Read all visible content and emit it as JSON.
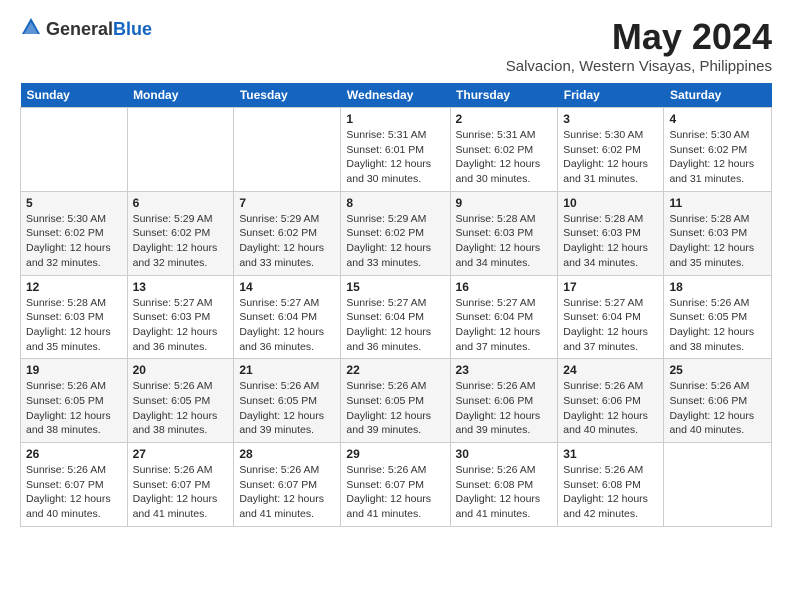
{
  "header": {
    "logo_general": "General",
    "logo_blue": "Blue",
    "month_title": "May 2024",
    "location": "Salvacion, Western Visayas, Philippines"
  },
  "days_of_week": [
    "Sunday",
    "Monday",
    "Tuesday",
    "Wednesday",
    "Thursday",
    "Friday",
    "Saturday"
  ],
  "weeks": [
    [
      {
        "day": "",
        "info": ""
      },
      {
        "day": "",
        "info": ""
      },
      {
        "day": "",
        "info": ""
      },
      {
        "day": "1",
        "info": "Sunrise: 5:31 AM\nSunset: 6:01 PM\nDaylight: 12 hours and 30 minutes."
      },
      {
        "day": "2",
        "info": "Sunrise: 5:31 AM\nSunset: 6:02 PM\nDaylight: 12 hours and 30 minutes."
      },
      {
        "day": "3",
        "info": "Sunrise: 5:30 AM\nSunset: 6:02 PM\nDaylight: 12 hours and 31 minutes."
      },
      {
        "day": "4",
        "info": "Sunrise: 5:30 AM\nSunset: 6:02 PM\nDaylight: 12 hours and 31 minutes."
      }
    ],
    [
      {
        "day": "5",
        "info": "Sunrise: 5:30 AM\nSunset: 6:02 PM\nDaylight: 12 hours and 32 minutes."
      },
      {
        "day": "6",
        "info": "Sunrise: 5:29 AM\nSunset: 6:02 PM\nDaylight: 12 hours and 32 minutes."
      },
      {
        "day": "7",
        "info": "Sunrise: 5:29 AM\nSunset: 6:02 PM\nDaylight: 12 hours and 33 minutes."
      },
      {
        "day": "8",
        "info": "Sunrise: 5:29 AM\nSunset: 6:02 PM\nDaylight: 12 hours and 33 minutes."
      },
      {
        "day": "9",
        "info": "Sunrise: 5:28 AM\nSunset: 6:03 PM\nDaylight: 12 hours and 34 minutes."
      },
      {
        "day": "10",
        "info": "Sunrise: 5:28 AM\nSunset: 6:03 PM\nDaylight: 12 hours and 34 minutes."
      },
      {
        "day": "11",
        "info": "Sunrise: 5:28 AM\nSunset: 6:03 PM\nDaylight: 12 hours and 35 minutes."
      }
    ],
    [
      {
        "day": "12",
        "info": "Sunrise: 5:28 AM\nSunset: 6:03 PM\nDaylight: 12 hours and 35 minutes."
      },
      {
        "day": "13",
        "info": "Sunrise: 5:27 AM\nSunset: 6:03 PM\nDaylight: 12 hours and 36 minutes."
      },
      {
        "day": "14",
        "info": "Sunrise: 5:27 AM\nSunset: 6:04 PM\nDaylight: 12 hours and 36 minutes."
      },
      {
        "day": "15",
        "info": "Sunrise: 5:27 AM\nSunset: 6:04 PM\nDaylight: 12 hours and 36 minutes."
      },
      {
        "day": "16",
        "info": "Sunrise: 5:27 AM\nSunset: 6:04 PM\nDaylight: 12 hours and 37 minutes."
      },
      {
        "day": "17",
        "info": "Sunrise: 5:27 AM\nSunset: 6:04 PM\nDaylight: 12 hours and 37 minutes."
      },
      {
        "day": "18",
        "info": "Sunrise: 5:26 AM\nSunset: 6:05 PM\nDaylight: 12 hours and 38 minutes."
      }
    ],
    [
      {
        "day": "19",
        "info": "Sunrise: 5:26 AM\nSunset: 6:05 PM\nDaylight: 12 hours and 38 minutes."
      },
      {
        "day": "20",
        "info": "Sunrise: 5:26 AM\nSunset: 6:05 PM\nDaylight: 12 hours and 38 minutes."
      },
      {
        "day": "21",
        "info": "Sunrise: 5:26 AM\nSunset: 6:05 PM\nDaylight: 12 hours and 39 minutes."
      },
      {
        "day": "22",
        "info": "Sunrise: 5:26 AM\nSunset: 6:05 PM\nDaylight: 12 hours and 39 minutes."
      },
      {
        "day": "23",
        "info": "Sunrise: 5:26 AM\nSunset: 6:06 PM\nDaylight: 12 hours and 39 minutes."
      },
      {
        "day": "24",
        "info": "Sunrise: 5:26 AM\nSunset: 6:06 PM\nDaylight: 12 hours and 40 minutes."
      },
      {
        "day": "25",
        "info": "Sunrise: 5:26 AM\nSunset: 6:06 PM\nDaylight: 12 hours and 40 minutes."
      }
    ],
    [
      {
        "day": "26",
        "info": "Sunrise: 5:26 AM\nSunset: 6:07 PM\nDaylight: 12 hours and 40 minutes."
      },
      {
        "day": "27",
        "info": "Sunrise: 5:26 AM\nSunset: 6:07 PM\nDaylight: 12 hours and 41 minutes."
      },
      {
        "day": "28",
        "info": "Sunrise: 5:26 AM\nSunset: 6:07 PM\nDaylight: 12 hours and 41 minutes."
      },
      {
        "day": "29",
        "info": "Sunrise: 5:26 AM\nSunset: 6:07 PM\nDaylight: 12 hours and 41 minutes."
      },
      {
        "day": "30",
        "info": "Sunrise: 5:26 AM\nSunset: 6:08 PM\nDaylight: 12 hours and 41 minutes."
      },
      {
        "day": "31",
        "info": "Sunrise: 5:26 AM\nSunset: 6:08 PM\nDaylight: 12 hours and 42 minutes."
      },
      {
        "day": "",
        "info": ""
      }
    ]
  ]
}
